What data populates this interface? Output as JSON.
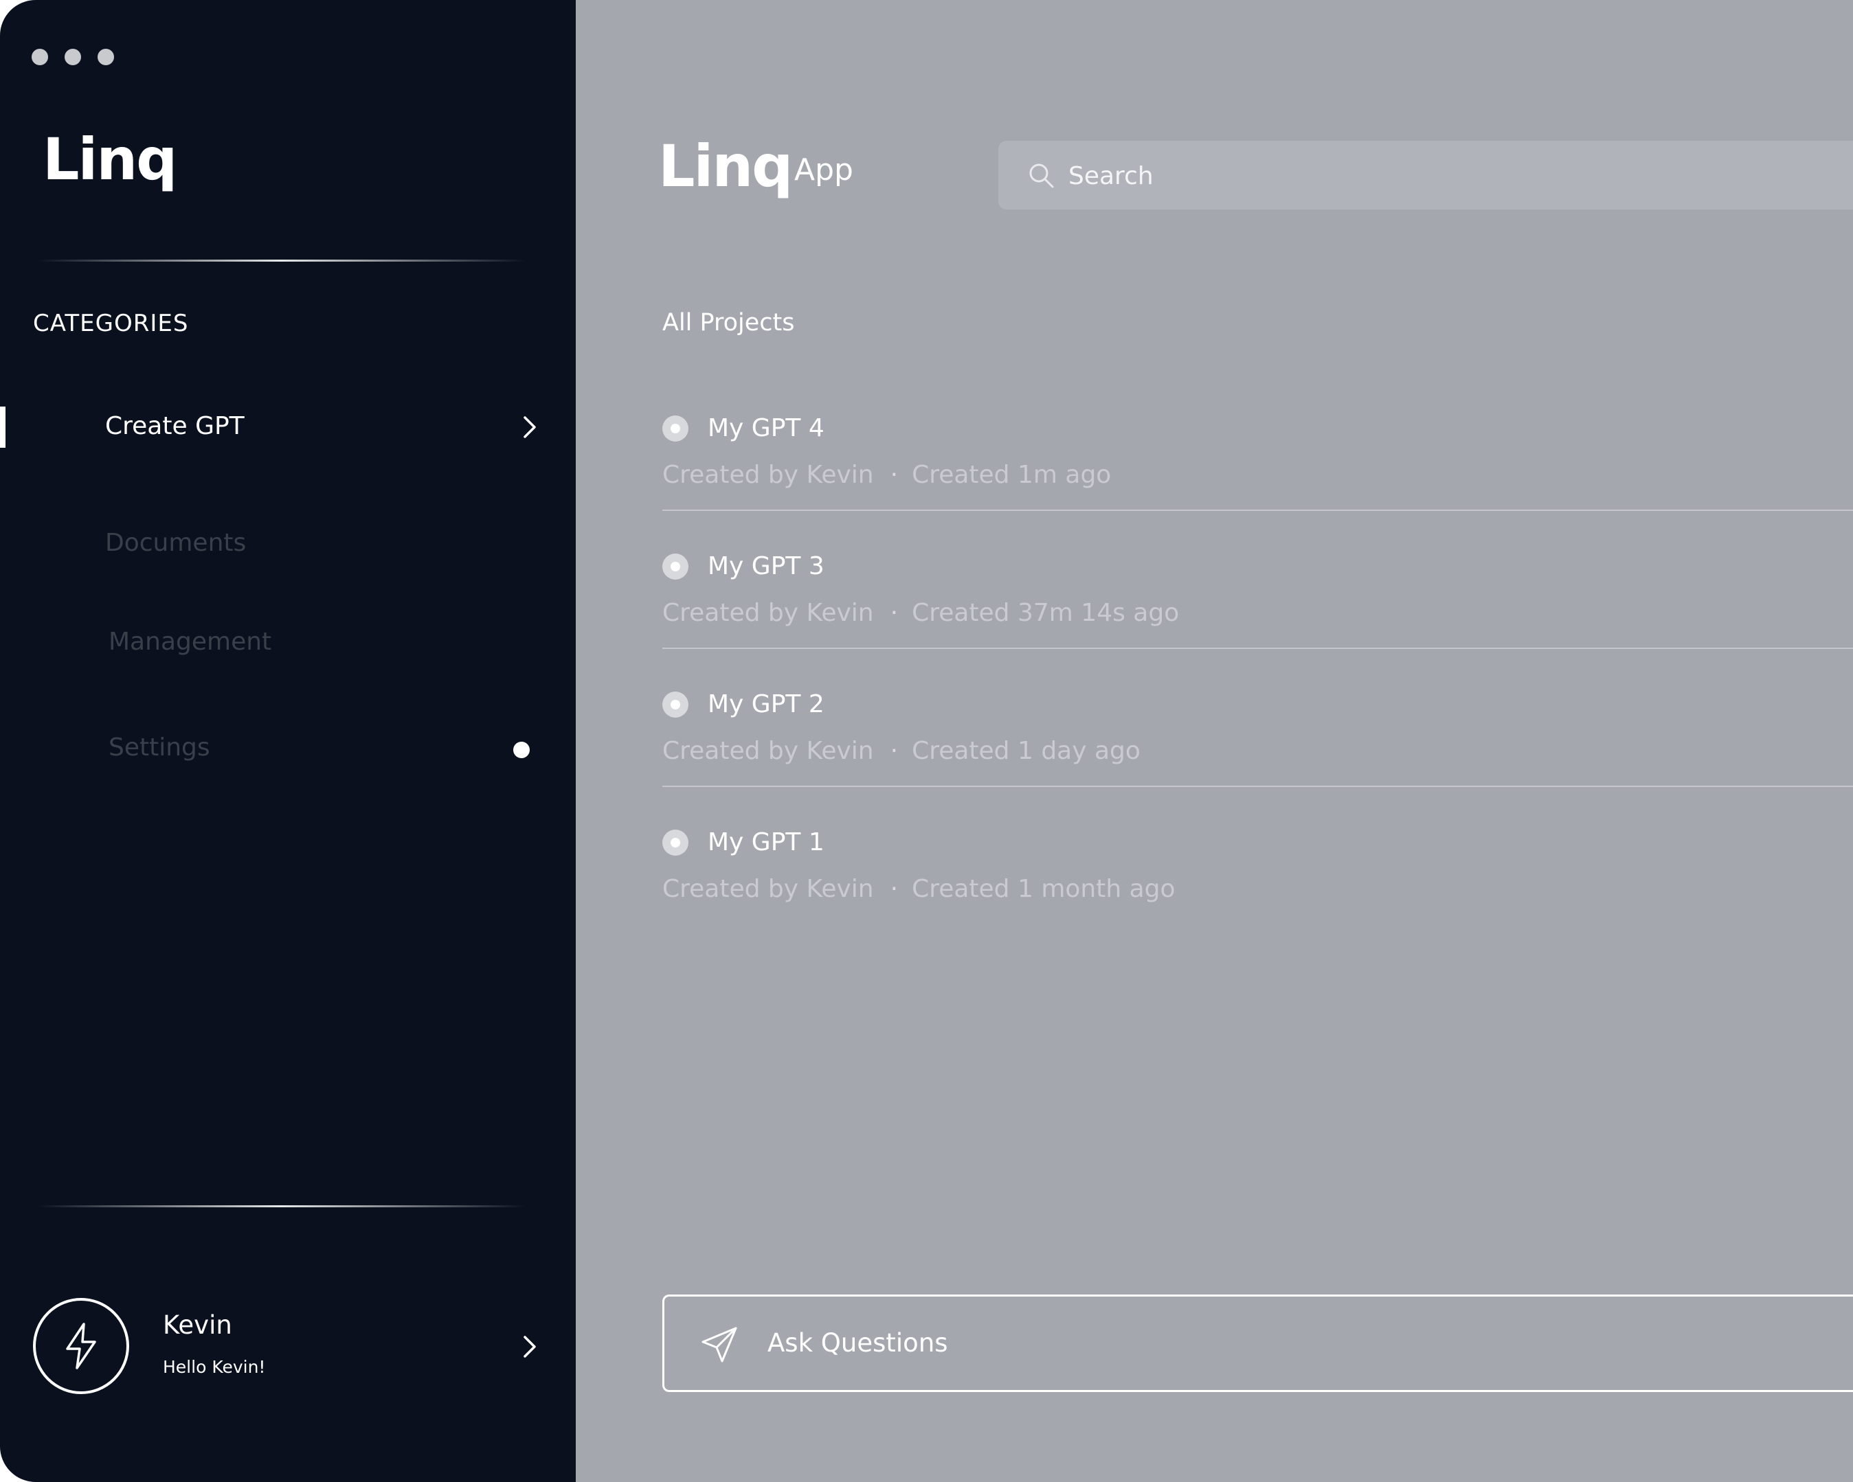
{
  "window": {
    "controls": [
      "close",
      "minimize",
      "maximize"
    ]
  },
  "sidebar": {
    "logo": "Linq",
    "categories_label": "CATEGORIES",
    "items": [
      {
        "label": "Create GPT",
        "active": true
      },
      {
        "label": "Documents",
        "active": false
      },
      {
        "label": "Management",
        "active": false
      },
      {
        "label": "Settings",
        "active": false,
        "has_notification_dot": true
      }
    ],
    "user": {
      "name": "Kevin",
      "greeting": "Hello Kevin!",
      "avatar_icon": "lightning-icon"
    }
  },
  "header": {
    "logo": "Linq",
    "app_label": "App",
    "search": {
      "placeholder": "Search",
      "value": "",
      "icon": "search-icon"
    }
  },
  "main": {
    "section_title": "All Projects",
    "projects": [
      {
        "name": "My GPT 4",
        "created_by": "Created by Kevin",
        "created": "Created 1m ago"
      },
      {
        "name": "My GPT 3",
        "created_by": "Created by Kevin",
        "created": "Created 37m 14s ago"
      },
      {
        "name": "My GPT 2",
        "created_by": "Created by Kevin",
        "created": "Created 1 day ago"
      },
      {
        "name": "My GPT 1",
        "created_by": "Created by Kevin",
        "created": "Created 1 month ago"
      }
    ],
    "separator": "·",
    "ask": {
      "label": "Ask Questions",
      "icon": "send-icon"
    }
  },
  "colors": {
    "sidebar_bg": "#0a101e",
    "main_bg": "#a4a7ae",
    "inactive_nav_text": "#3a3f4a",
    "text_primary": "#ffffff"
  }
}
